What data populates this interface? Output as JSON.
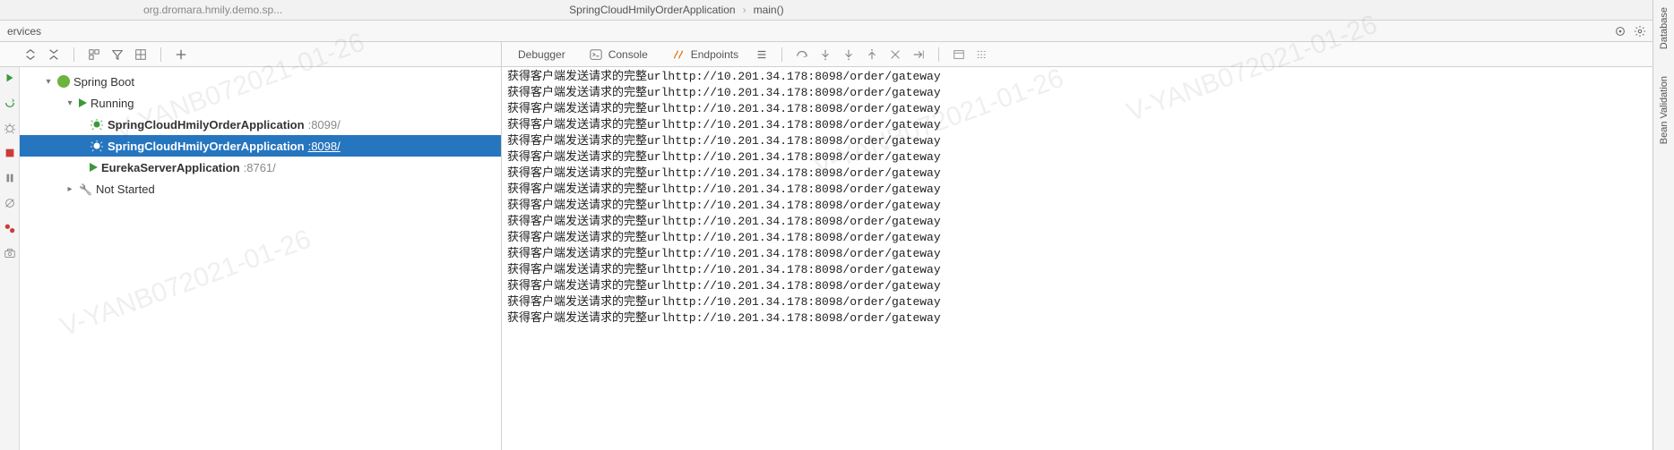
{
  "top": {
    "package": "org.dromara.hmily.demo.sp...",
    "breadcrumb": [
      "SpringCloudHmilyOrderApplication",
      "main()"
    ]
  },
  "panel": {
    "title": "ervices"
  },
  "tabs": {
    "debugger": "Debugger",
    "console": "Console",
    "endpoints": "Endpoints"
  },
  "tree": {
    "root": "Spring Boot",
    "running": "Running",
    "notstarted": "Not Started",
    "apps": [
      {
        "name": "SpringCloudHmilyOrderApplication",
        "port": ":8099/",
        "selected": false
      },
      {
        "name": "SpringCloudHmilyOrderApplication",
        "port": ":8098/",
        "selected": true
      },
      {
        "name": "EurekaServerApplication",
        "port": ":8761/",
        "selected": false
      }
    ]
  },
  "console": {
    "prefix": "获得客户端发送请求的完整url",
    "url": "http://10.201.34.178:8098/order/gateway",
    "lines": 16
  },
  "sidebars": {
    "database": "Database",
    "beanvalidation": "Bean Validation"
  },
  "watermark": "V-YANB072021-01-26"
}
